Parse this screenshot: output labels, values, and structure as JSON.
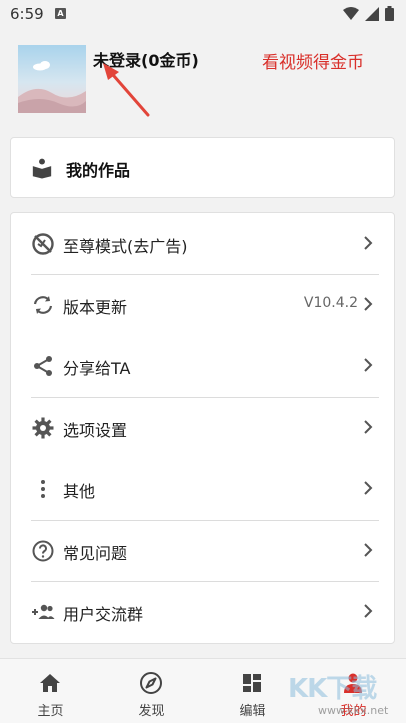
{
  "status_bar": {
    "time": "6:59",
    "notification_badge": "A"
  },
  "profile": {
    "username": "未登录(0金币)",
    "promo_link": "看视频得金币"
  },
  "works": {
    "label": "我的作品"
  },
  "menu": [
    {
      "label": "至尊模式(去广告)",
      "icon": "no-ads-icon"
    },
    {
      "label": "版本更新",
      "icon": "sync-icon",
      "value": "V10.4.2"
    },
    {
      "label": "分享给TA",
      "icon": "share-icon"
    },
    {
      "label": "选项设置",
      "icon": "gear-icon"
    },
    {
      "label": "其他",
      "icon": "more-vert-icon"
    },
    {
      "label": "常见问题",
      "icon": "help-icon"
    },
    {
      "label": "用户交流群",
      "icon": "add-group-icon"
    }
  ],
  "tabs": [
    {
      "label": "主页",
      "icon": "home-icon"
    },
    {
      "label": "发现",
      "icon": "compass-icon"
    },
    {
      "label": "编辑",
      "icon": "dashboard-icon"
    },
    {
      "label": "我的",
      "icon": "person-icon",
      "active": true
    }
  ],
  "watermark": {
    "text": "KK下载",
    "url": "www.kkx.net"
  },
  "colors": {
    "accent_red": "#d9302b",
    "icon_gray": "#555555"
  }
}
